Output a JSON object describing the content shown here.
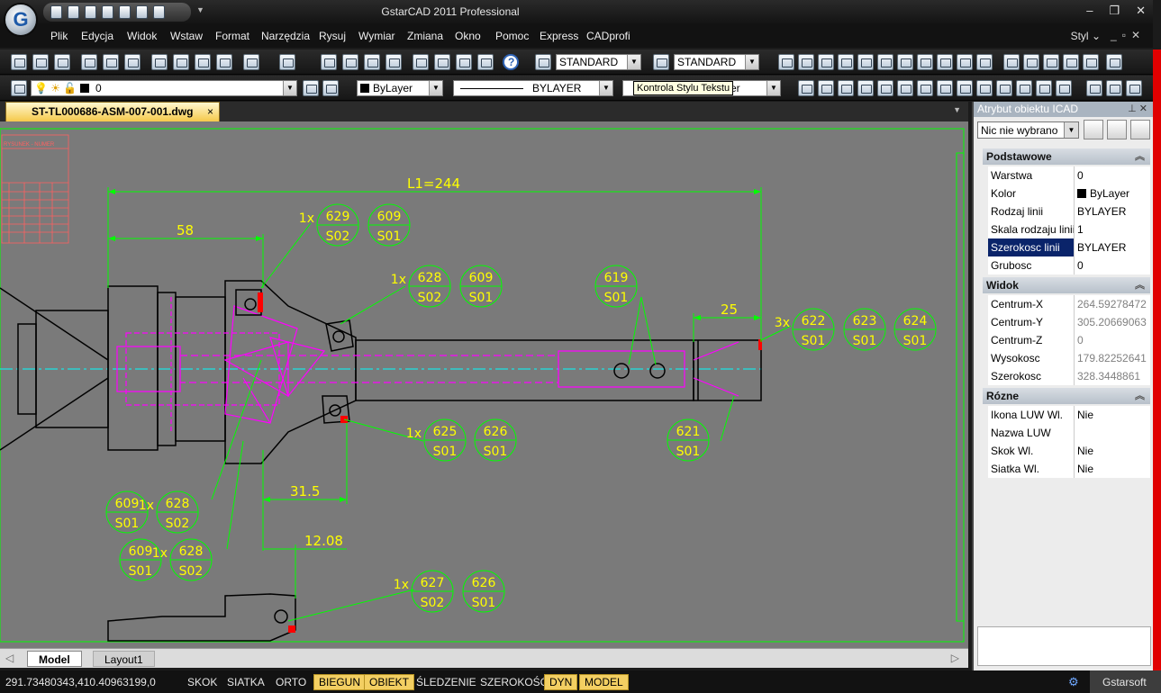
{
  "app": {
    "title": "GstarCAD 2011 Professional",
    "logo": "G"
  },
  "menu": [
    "Plik",
    "Edycja",
    "Widok",
    "Wstaw",
    "Format",
    "Narzędzia",
    "Rysuj",
    "Wymiar",
    "Zmiana",
    "Okno",
    "Pomoc",
    "Express",
    "CADprofi"
  ],
  "styl": "Styl",
  "toolbar": {
    "text_style": "STANDARD",
    "dim_style": "STANDARD",
    "layer": "0",
    "color": "ByLayer",
    "linetype": "BYLAYER",
    "lineweight_partial": "yer",
    "tooltip": "Kontrola Stylu Tekstu"
  },
  "doc_tab": {
    "name": "ST-TL000686-ASM-007-001.dwg",
    "close": "×"
  },
  "drawing": {
    "dims": {
      "L": "L1=244",
      "d58": "58",
      "d25": "25",
      "d315": "31.5",
      "d1208": "12.08"
    },
    "balloons": [
      {
        "q": "1x",
        "a": "629",
        "b": "S02"
      },
      {
        "q": "",
        "a": "609",
        "b": "S01"
      },
      {
        "q": "1x",
        "a": "628",
        "b": "S02"
      },
      {
        "q": "",
        "a": "609",
        "b": "S01"
      },
      {
        "q": "",
        "a": "619",
        "b": "S01"
      },
      {
        "q": "3x",
        "a": "622",
        "b": "S01"
      },
      {
        "q": "",
        "a": "623",
        "b": "S01"
      },
      {
        "q": "",
        "a": "624",
        "b": "S01"
      },
      {
        "q": "1x",
        "a": "625",
        "b": "S01"
      },
      {
        "q": "",
        "a": "626",
        "b": "S01"
      },
      {
        "q": "",
        "a": "621",
        "b": "S01"
      },
      {
        "q": "",
        "a": "609",
        "b": "S01"
      },
      {
        "q": "1x",
        "a": "628",
        "b": "S02"
      },
      {
        "q": "",
        "a": "609",
        "b": "S01"
      },
      {
        "q": "1x",
        "a": "628",
        "b": "S02"
      },
      {
        "q": "1x",
        "a": "627",
        "b": "S02"
      },
      {
        "q": "",
        "a": "626",
        "b": "S01"
      }
    ],
    "table_header": "RYSUNEK - NUMER"
  },
  "layout_tabs": {
    "model": "Model",
    "layout1": "Layout1"
  },
  "status": {
    "coords": "291.73480343,410.40963199,0",
    "buttons": [
      {
        "label": "SKOK",
        "on": false
      },
      {
        "label": "SIATKA",
        "on": false
      },
      {
        "label": "ORTO",
        "on": false
      },
      {
        "label": "BIEGUN",
        "on": true
      },
      {
        "label": "OBIEKT",
        "on": true
      },
      {
        "label": "ŚLEDZENIE",
        "on": false
      },
      {
        "label": "SZEROKOŚĆ",
        "on": false
      },
      {
        "label": "DYN",
        "on": true
      },
      {
        "label": "MODEL",
        "on": true
      }
    ],
    "brand": "Gstarsoft"
  },
  "properties": {
    "title": "Atrybut obiektu ICAD",
    "selection": "Nic nie wybrano",
    "categories": [
      {
        "name": "Podstawowe",
        "rows": [
          {
            "k": "Warstwa",
            "v": "0"
          },
          {
            "k": "Kolor",
            "v": "ByLayer"
          },
          {
            "k": "Rodzaj linii",
            "v": "BYLAYER"
          },
          {
            "k": "Skala rodzaju linii",
            "v": "1"
          },
          {
            "k": "Szerokosc linii",
            "v": "BYLAYER"
          },
          {
            "k": "Grubosc",
            "v": "0"
          }
        ]
      },
      {
        "name": "Widok",
        "rows": [
          {
            "k": "Centrum-X",
            "v": "264.59278472"
          },
          {
            "k": "Centrum-Y",
            "v": "305.20669063"
          },
          {
            "k": "Centrum-Z",
            "v": "0"
          },
          {
            "k": "Wysokosc",
            "v": "179.82252641"
          },
          {
            "k": "Szerokosc",
            "v": "328.3448861"
          }
        ]
      },
      {
        "name": "Rózne",
        "rows": [
          {
            "k": "Ikona LUW Wl.",
            "v": "Nie"
          },
          {
            "k": "Nazwa LUW",
            "v": ""
          },
          {
            "k": "Skok Wl.",
            "v": "Nie"
          },
          {
            "k": "Siatka Wl.",
            "v": "Nie"
          }
        ]
      }
    ]
  },
  "colors": {
    "drawing_bg": "#7a7a7a",
    "green": "#00ff00",
    "yellow": "#ffff00",
    "magenta": "#ff00ff",
    "cyan": "#00ffff",
    "red": "#ff0000"
  }
}
